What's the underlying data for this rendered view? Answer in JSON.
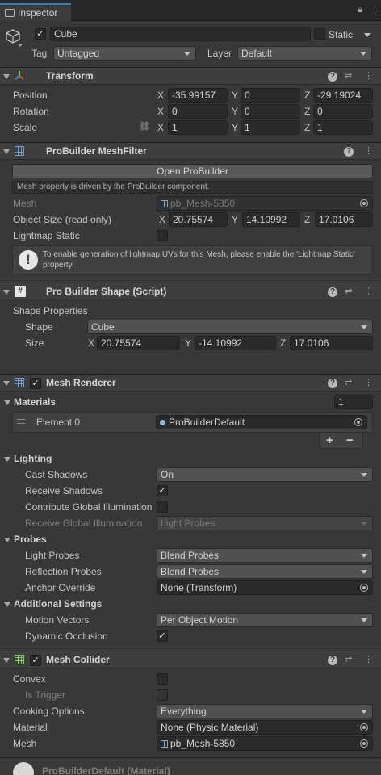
{
  "tab": {
    "label": "Inspector"
  },
  "object": {
    "name": "Cube",
    "static_label": "Static",
    "tag_label": "Tag",
    "tag_value": "Untagged",
    "layer_label": "Layer",
    "layer_value": "Default"
  },
  "transform": {
    "title": "Transform",
    "position": {
      "label": "Position",
      "x": "-35.99157",
      "y": "0",
      "z": "-29.19024"
    },
    "rotation": {
      "label": "Rotation",
      "x": "0",
      "y": "0",
      "z": "0"
    },
    "scale": {
      "label": "Scale",
      "x": "1",
      "y": "1",
      "z": "1"
    },
    "axis_x": "X",
    "axis_y": "Y",
    "axis_z": "Z"
  },
  "meshfilter": {
    "title": "ProBuilder MeshFilter",
    "open_button": "Open ProBuilder",
    "info": "Mesh property is driven by the ProBuilder component.",
    "mesh_label": "Mesh",
    "mesh_value": "pb_Mesh-5850",
    "size_label": "Object Size (read only)",
    "size_x": "20.75574",
    "size_y": "14.10992",
    "size_z": "17.0106",
    "lightmap_label": "Lightmap Static",
    "help_text": "To enable generation of lightmap UVs for this Mesh, please enable the 'Lightmap Static' property."
  },
  "shape": {
    "title": "Pro Builder Shape (Script)",
    "props_label": "Shape Properties",
    "shape_label": "Shape",
    "shape_value": "Cube",
    "size_label": "Size",
    "x": "20.75574",
    "y": "-14.10992",
    "z": "17.0106"
  },
  "renderer": {
    "title": "Mesh Renderer",
    "materials_label": "Materials",
    "materials_count": "1",
    "element_label": "Element 0",
    "element_value": "ProBuilderDefault",
    "plus": "+",
    "minus": "−",
    "lighting_label": "Lighting",
    "cast_shadows_label": "Cast Shadows",
    "cast_shadows_value": "On",
    "receive_shadows_label": "Receive Shadows",
    "contribute_gi_label": "Contribute Global Illumination",
    "receive_gi_label": "Receive Global Illumination",
    "receive_gi_value": "Light Probes",
    "probes_label": "Probes",
    "light_probes_label": "Light Probes",
    "light_probes_value": "Blend Probes",
    "reflection_probes_label": "Reflection Probes",
    "reflection_probes_value": "Blend Probes",
    "anchor_label": "Anchor Override",
    "anchor_value": "None (Transform)",
    "additional_label": "Additional Settings",
    "motion_label": "Motion Vectors",
    "motion_value": "Per Object Motion",
    "occlusion_label": "Dynamic Occlusion"
  },
  "collider": {
    "title": "Mesh Collider",
    "convex_label": "Convex",
    "trigger_label": "Is Trigger",
    "cooking_label": "Cooking Options",
    "cooking_value": "Everything",
    "material_label": "Material",
    "material_value": "None (Physic Material)",
    "mesh_label": "Mesh",
    "mesh_value": "pb_Mesh-5850"
  },
  "footer": {
    "material_preview": "ProBuilderDefault (Material)"
  },
  "colors": {
    "accent": "#3a79bb",
    "background": "#383838",
    "header": "#3e3e3e"
  }
}
